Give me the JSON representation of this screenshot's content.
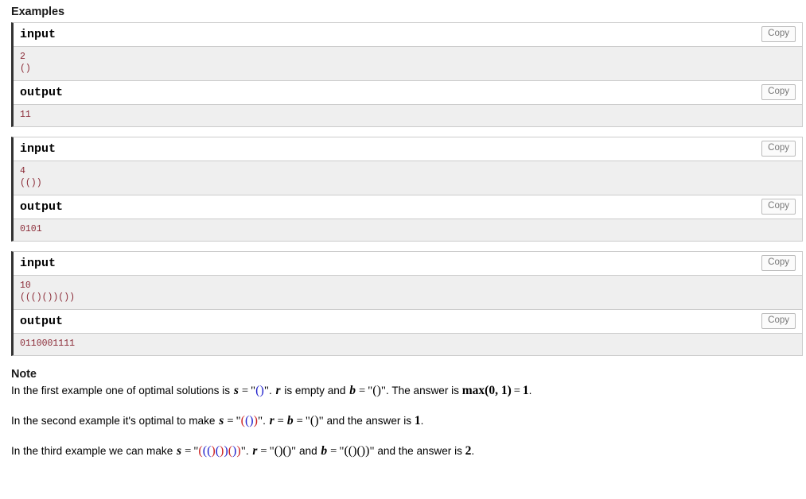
{
  "examples": {
    "heading": "Examples",
    "copy_label": "Copy",
    "input_label": "input",
    "output_label": "output",
    "tests": [
      {
        "input": "2\n()",
        "output": "11"
      },
      {
        "input": "4\n(())",
        "output": "0101"
      },
      {
        "input": "10\n((()())())",
        "output": "0110001111"
      }
    ]
  },
  "note": {
    "heading": "Note",
    "paragraphs": [
      {
        "id": "note-first-example",
        "parts": [
          {
            "t": "text",
            "v": "In the first example one of optimal solutions is "
          },
          {
            "t": "var",
            "v": "s"
          },
          {
            "t": "op",
            "v": "="
          },
          {
            "t": "quote",
            "v": "\""
          },
          {
            "t": "parens",
            "v": "()",
            "colors": [
              "blue",
              "blue"
            ]
          },
          {
            "t": "quote",
            "v": "\""
          },
          {
            "t": "text",
            "v": ". "
          },
          {
            "t": "var",
            "v": "r"
          },
          {
            "t": "text",
            "v": " is empty and "
          },
          {
            "t": "var",
            "v": "b"
          },
          {
            "t": "op",
            "v": "="
          },
          {
            "t": "quote",
            "v": "\""
          },
          {
            "t": "parens",
            "v": "()",
            "colors": [
              "black",
              "black"
            ]
          },
          {
            "t": "quote",
            "v": "\""
          },
          {
            "t": "text",
            "v": ". The answer is "
          },
          {
            "t": "fun",
            "v": "max"
          },
          {
            "t": "num",
            "v": "(0, 1)"
          },
          {
            "t": "op",
            "v": "="
          },
          {
            "t": "num",
            "v": "1"
          },
          {
            "t": "text",
            "v": "."
          }
        ]
      },
      {
        "id": "note-second-example",
        "parts": [
          {
            "t": "text",
            "v": "In the second example it's optimal to make "
          },
          {
            "t": "var",
            "v": "s"
          },
          {
            "t": "op",
            "v": "="
          },
          {
            "t": "quote",
            "v": "\""
          },
          {
            "t": "parens",
            "v": "(())",
            "colors": [
              "red",
              "blue",
              "blue",
              "red"
            ]
          },
          {
            "t": "quote",
            "v": "\""
          },
          {
            "t": "text",
            "v": ". "
          },
          {
            "t": "var",
            "v": "r"
          },
          {
            "t": "op",
            "v": "="
          },
          {
            "t": "var",
            "v": "b"
          },
          {
            "t": "op",
            "v": "="
          },
          {
            "t": "quote",
            "v": "\""
          },
          {
            "t": "parens",
            "v": "()",
            "colors": [
              "black",
              "black"
            ]
          },
          {
            "t": "quote",
            "v": "\""
          },
          {
            "t": "text",
            "v": " and the answer is "
          },
          {
            "t": "num",
            "v": "1"
          },
          {
            "t": "text",
            "v": "."
          }
        ]
      },
      {
        "id": "note-third-example",
        "parts": [
          {
            "t": "text",
            "v": "In the third example we can make "
          },
          {
            "t": "var",
            "v": "s"
          },
          {
            "t": "op",
            "v": "="
          },
          {
            "t": "quote",
            "v": "\""
          },
          {
            "t": "parens",
            "v": "((()())())",
            "colors": [
              "red",
              "blue",
              "blue",
              "red",
              "blue",
              "red",
              "blue",
              "red",
              "blue",
              "red"
            ]
          },
          {
            "t": "quote",
            "v": "\""
          },
          {
            "t": "text",
            "v": ". "
          },
          {
            "t": "var",
            "v": "r"
          },
          {
            "t": "op",
            "v": "="
          },
          {
            "t": "quote",
            "v": "\""
          },
          {
            "t": "parens",
            "v": "()()",
            "colors": [
              "black",
              "black",
              "black",
              "black"
            ]
          },
          {
            "t": "quote",
            "v": "\""
          },
          {
            "t": "text",
            "v": " and "
          },
          {
            "t": "var",
            "v": "b"
          },
          {
            "t": "op",
            "v": "="
          },
          {
            "t": "quote",
            "v": "\""
          },
          {
            "t": "parens",
            "v": "(()())",
            "colors": [
              "black",
              "black",
              "black",
              "black",
              "black",
              "black"
            ]
          },
          {
            "t": "quote",
            "v": "\""
          },
          {
            "t": "text",
            "v": " and the answer is "
          },
          {
            "t": "num",
            "v": "2"
          },
          {
            "t": "text",
            "v": "."
          }
        ]
      }
    ]
  },
  "colors": {
    "sample_bg": "#efefef",
    "sample_text": "#8b2b37",
    "border": "#cccccc",
    "accent_left": "#333333",
    "paren_blue": "#2222cc",
    "paren_red": "#cc2222"
  }
}
